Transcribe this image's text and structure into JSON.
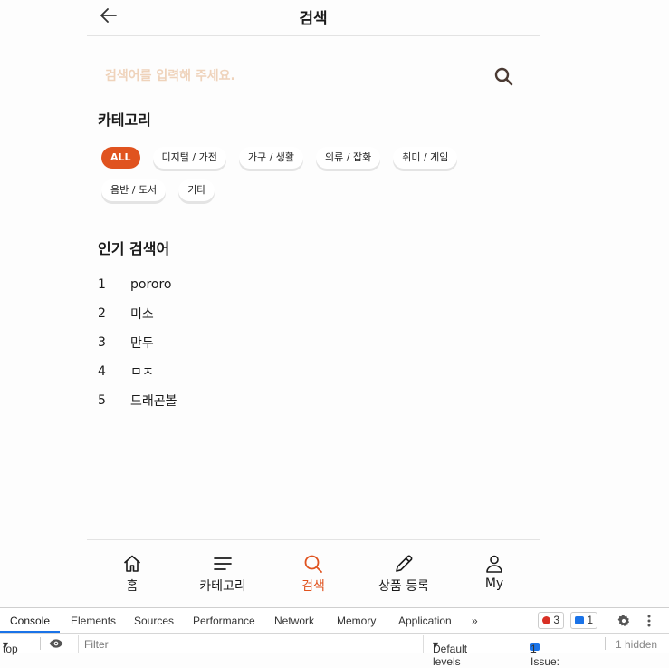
{
  "header": {
    "title": "검색"
  },
  "search": {
    "placeholder": "검색어를 입력해 주세요."
  },
  "category": {
    "title": "카테고리",
    "chips": [
      "ALL",
      "디지털 / 가전",
      "가구 / 생활",
      "의류 / 잡화",
      "취미 / 게임",
      "음반 / 도서",
      "기타"
    ],
    "active": "ALL"
  },
  "popular": {
    "title": "인기 검색어",
    "items": [
      {
        "rank": "1",
        "term": "pororo"
      },
      {
        "rank": "2",
        "term": "미소"
      },
      {
        "rank": "3",
        "term": "만두"
      },
      {
        "rank": "4",
        "term": "ㅁㅈ"
      },
      {
        "rank": "5",
        "term": "드래곤볼"
      }
    ]
  },
  "nav": {
    "items": [
      {
        "label": "홈",
        "icon": "home-icon"
      },
      {
        "label": "카테고리",
        "icon": "menu-icon"
      },
      {
        "label": "검색",
        "icon": "search-icon",
        "active": true
      },
      {
        "label": "상품 등록",
        "icon": "pencil-icon"
      },
      {
        "label": "My",
        "icon": "user-icon"
      }
    ]
  },
  "devtools": {
    "tabs": [
      "Console",
      "Elements",
      "Sources",
      "Performance",
      "Network",
      "Memory",
      "Application"
    ],
    "more": "»",
    "error_count": "3",
    "message_count": "1",
    "context": "top",
    "filter_placeholder": "Filter",
    "levels": "Default levels",
    "issues": "1 Issue:",
    "issue_count": "1",
    "hidden": "1 hidden"
  },
  "colors": {
    "accent": "#e0531f",
    "placeholder": "#efd3bb"
  }
}
